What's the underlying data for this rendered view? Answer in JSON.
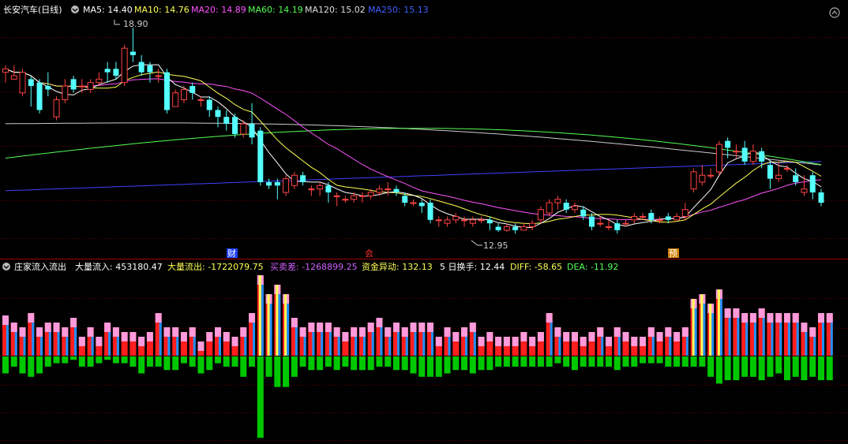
{
  "header": {
    "title": "长安汽车(日线)",
    "ma5": "MA5: 14.40",
    "ma10": "MA10: 14.76",
    "ma20": "MA20: 14.89",
    "ma60": "MA60: 14.19",
    "ma120": "MA120: 15.02",
    "ma250": "MA250: 15.13"
  },
  "price_panel": {
    "high_label": "18.90",
    "low_label": "12.95",
    "marker_cai": "财",
    "marker_hui": "会",
    "marker_yu": "预"
  },
  "indicator_header": {
    "name": "庄家流入流出",
    "inflow": "大量流入: 453180.47",
    "outflow": "大量流出: -1722079.75",
    "diff_buy_sell": "买卖差: -1268899.25",
    "fund_change": "资金异动: 132.13",
    "turnover5": "5 日换手: 12.44",
    "diff": "DIFF: -58.65",
    "dea": "DEA: -11.92"
  },
  "colors": {
    "up": "#ff4444",
    "down": "#54ffff",
    "ma5": "#ffffff",
    "ma10": "#ffff54",
    "ma20": "#ff54ff",
    "ma60": "#54ff54",
    "ma120": "#cccccc",
    "ma250": "#4040ff",
    "inflow_top": "#ff9adb",
    "inflow_red": "#ff1e1e",
    "inflow_blue": "#1e90ff",
    "outflow": "#00c800",
    "grid": "#7a0000"
  },
  "chart_data": {
    "type": "candlestick",
    "series_names": [
      "MA5",
      "MA10",
      "MA20",
      "MA60",
      "MA120",
      "MA250"
    ],
    "ylim": [
      12.4,
      19.2
    ],
    "candles": [
      [
        17.6,
        17.7,
        17.3,
        17.8
      ],
      [
        17.4,
        17.5,
        17.4,
        17.8
      ],
      [
        17.0,
        17.6,
        16.9,
        17.7
      ],
      [
        17.4,
        17.2,
        16.6,
        17.5
      ],
      [
        17.3,
        16.5,
        16.4,
        17.4
      ],
      [
        17.2,
        17.1,
        16.9,
        17.6
      ],
      [
        16.3,
        16.8,
        16.2,
        16.9
      ],
      [
        16.8,
        17.2,
        16.7,
        17.4
      ],
      [
        17.4,
        17.1,
        17.0,
        17.5
      ],
      [
        17.2,
        17.2,
        17.0,
        17.4
      ],
      [
        17.1,
        17.3,
        17.0,
        17.4
      ],
      [
        17.3,
        17.4,
        17.2,
        17.6
      ],
      [
        17.7,
        17.6,
        17.3,
        17.9
      ],
      [
        17.7,
        17.5,
        17.4,
        17.9
      ],
      [
        17.3,
        18.3,
        17.2,
        18.4
      ],
      [
        18.2,
        18.1,
        17.9,
        18.9
      ],
      [
        17.9,
        17.6,
        17.5,
        18.1
      ],
      [
        17.8,
        17.6,
        17.3,
        17.9
      ],
      [
        17.5,
        17.5,
        17.3,
        17.7
      ],
      [
        17.6,
        16.5,
        16.4,
        17.7
      ],
      [
        16.6,
        17.0,
        16.6,
        17.1
      ],
      [
        16.8,
        17.1,
        16.7,
        17.2
      ],
      [
        17.2,
        17.0,
        16.8,
        17.3
      ],
      [
        16.8,
        16.8,
        16.6,
        16.9
      ],
      [
        16.8,
        16.5,
        16.3,
        16.9
      ],
      [
        16.5,
        16.3,
        16.0,
        16.6
      ],
      [
        16.3,
        16.1,
        15.9,
        16.5
      ],
      [
        16.3,
        15.8,
        15.7,
        16.4
      ],
      [
        15.8,
        16.1,
        15.7,
        16.2
      ],
      [
        16.1,
        15.7,
        15.5,
        16.7
      ],
      [
        15.9,
        14.4,
        14.3,
        16.0
      ],
      [
        14.4,
        14.3,
        14.2,
        14.5
      ],
      [
        14.4,
        14.3,
        13.9,
        14.5
      ],
      [
        14.1,
        14.5,
        14.0,
        14.6
      ],
      [
        14.3,
        14.6,
        14.2,
        14.7
      ],
      [
        14.6,
        14.4,
        14.3,
        14.7
      ],
      [
        14.2,
        14.2,
        14.0,
        14.3
      ],
      [
        14.2,
        14.3,
        14.0,
        14.4
      ],
      [
        14.3,
        14.1,
        13.8,
        14.4
      ],
      [
        14.0,
        14.0,
        13.7,
        14.1
      ],
      [
        13.9,
        13.9,
        13.8,
        14.0
      ],
      [
        13.9,
        14.0,
        13.8,
        14.1
      ],
      [
        14.0,
        14.0,
        13.8,
        14.1
      ],
      [
        14.0,
        14.1,
        13.9,
        14.2
      ],
      [
        14.1,
        14.2,
        14.0,
        14.3
      ],
      [
        14.2,
        14.2,
        14.0,
        14.4
      ],
      [
        14.2,
        14.1,
        14.0,
        14.3
      ],
      [
        14.0,
        13.8,
        13.7,
        14.1
      ],
      [
        13.8,
        13.8,
        13.7,
        13.9
      ],
      [
        13.8,
        13.7,
        13.5,
        13.9
      ],
      [
        13.8,
        13.3,
        13.2,
        13.9
      ],
      [
        13.3,
        13.3,
        13.1,
        13.4
      ],
      [
        13.2,
        13.3,
        13.1,
        13.4
      ],
      [
        13.3,
        13.4,
        13.2,
        13.5
      ],
      [
        13.3,
        13.3,
        13.1,
        13.4
      ],
      [
        13.2,
        13.3,
        13.1,
        13.4
      ],
      [
        13.3,
        13.3,
        13.2,
        13.4
      ],
      [
        13.3,
        13.2,
        13.0,
        13.4
      ],
      [
        13.1,
        13.0,
        12.95,
        13.2
      ],
      [
        13.0,
        13.1,
        12.95,
        13.2
      ],
      [
        13.1,
        13.0,
        12.9,
        13.2
      ],
      [
        13.0,
        13.1,
        13.0,
        13.2
      ],
      [
        13.1,
        13.2,
        13.0,
        13.3
      ],
      [
        13.3,
        13.6,
        13.2,
        13.7
      ],
      [
        13.5,
        13.8,
        13.4,
        13.9
      ],
      [
        13.8,
        13.9,
        13.6,
        14.0
      ],
      [
        13.8,
        13.6,
        13.5,
        13.9
      ],
      [
        13.6,
        13.7,
        13.5,
        13.8
      ],
      [
        13.6,
        13.4,
        13.3,
        13.7
      ],
      [
        13.4,
        13.1,
        13.0,
        13.5
      ],
      [
        13.2,
        13.2,
        13.1,
        13.4
      ],
      [
        13.1,
        13.1,
        13.0,
        13.3
      ],
      [
        13.2,
        13.0,
        12.9,
        13.3
      ],
      [
        13.2,
        13.2,
        13.1,
        13.3
      ],
      [
        13.3,
        13.4,
        13.2,
        13.5
      ],
      [
        13.4,
        13.4,
        13.3,
        13.5
      ],
      [
        13.5,
        13.3,
        13.2,
        13.6
      ],
      [
        13.3,
        13.3,
        13.2,
        13.4
      ],
      [
        13.4,
        13.3,
        13.2,
        13.5
      ],
      [
        13.3,
        13.4,
        13.3,
        13.5
      ],
      [
        13.4,
        13.6,
        13.3,
        13.8
      ],
      [
        14.2,
        14.7,
        14.1,
        14.8
      ],
      [
        14.4,
        14.6,
        14.3,
        14.9
      ],
      [
        14.6,
        14.6,
        14.5,
        14.8
      ],
      [
        14.7,
        15.5,
        14.6,
        15.6
      ],
      [
        15.6,
        15.4,
        15.1,
        15.7
      ],
      [
        15.3,
        15.3,
        15.1,
        15.5
      ],
      [
        15.4,
        15.0,
        14.9,
        15.6
      ],
      [
        15.0,
        15.3,
        14.9,
        15.5
      ],
      [
        15.3,
        15.0,
        14.8,
        15.4
      ],
      [
        14.9,
        14.5,
        14.2,
        15.0
      ],
      [
        14.5,
        14.6,
        14.4,
        15.0
      ],
      [
        14.8,
        14.8,
        14.7,
        14.9
      ],
      [
        14.6,
        14.4,
        14.3,
        14.8
      ],
      [
        14.1,
        14.2,
        14.0,
        14.6
      ],
      [
        14.6,
        14.1,
        13.9,
        14.7
      ],
      [
        14.1,
        13.8,
        13.7,
        14.2
      ]
    ],
    "inflow": [
      8.5,
      7,
      6,
      9,
      6,
      7,
      7,
      6,
      8,
      4,
      6,
      4,
      7,
      6,
      5,
      5,
      4,
      5,
      9,
      6,
      6,
      5,
      6,
      3,
      5,
      6,
      5,
      4,
      6,
      9,
      17,
      13,
      15,
      13,
      8,
      6,
      7,
      7,
      7,
      6,
      5,
      6,
      6,
      7,
      8,
      6,
      7,
      6,
      7,
      7,
      7,
      4,
      6,
      5,
      6,
      7,
      4,
      5,
      4,
      4,
      4,
      5,
      4,
      5,
      9,
      6,
      5,
      5,
      4,
      5,
      6,
      4,
      6,
      5,
      4,
      4,
      6,
      5,
      6,
      5,
      6,
      12,
      13,
      11,
      14,
      10,
      10,
      9,
      9,
      10,
      9,
      9,
      9,
      9,
      7,
      6,
      9,
      9
    ],
    "outflow": [
      5,
      3,
      5,
      6,
      5,
      3,
      2,
      2,
      1,
      3,
      3,
      2,
      1,
      2,
      2,
      3,
      5,
      3,
      3,
      4,
      4,
      2,
      3,
      5,
      4,
      2,
      3,
      3,
      6,
      3,
      24,
      6,
      9,
      9,
      6,
      3,
      4,
      4,
      3,
      4,
      3,
      4,
      4,
      4,
      3,
      3,
      4,
      4,
      5,
      6,
      6,
      6,
      5,
      4,
      4,
      5,
      4,
      4,
      3,
      3,
      3,
      3,
      3,
      3,
      3,
      2,
      3,
      4,
      3,
      3,
      3,
      3,
      4,
      3,
      3,
      2,
      2,
      2,
      3,
      3,
      3,
      3,
      3,
      6,
      8,
      7,
      7,
      6,
      6,
      7,
      6,
      5,
      7,
      6,
      7,
      6,
      7,
      7
    ]
  }
}
